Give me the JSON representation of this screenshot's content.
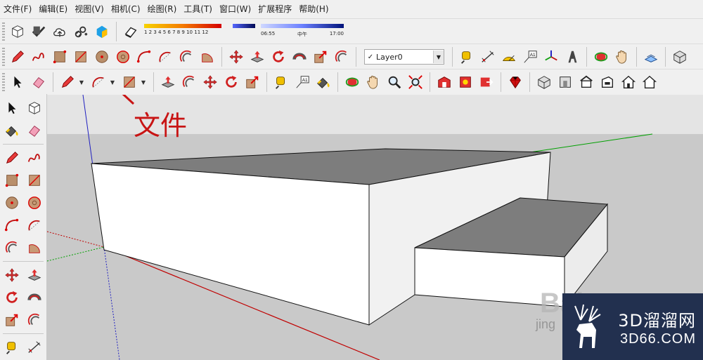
{
  "menubar": {
    "items": [
      {
        "label": "文件(F)"
      },
      {
        "label": "编辑(E)"
      },
      {
        "label": "视图(V)"
      },
      {
        "label": "相机(C)"
      },
      {
        "label": "绘图(R)"
      },
      {
        "label": "工具(T)"
      },
      {
        "label": "窗口(W)"
      },
      {
        "label": "扩展程序"
      },
      {
        "label": "帮助(H)"
      }
    ]
  },
  "toolbar": {
    "shadow_scale": "1 2 3 4 5 6 7 8 9 10 11 12",
    "time_start": "06:55",
    "time_mid": "中午",
    "time_end": "17:00",
    "layer_check": "✓",
    "layer_name": "Layer0"
  },
  "annotation": {
    "label": "文件",
    "color": "#c81414"
  },
  "watermark": {
    "brand_cn": "3D溜溜网",
    "brand_url": "3D66.COM",
    "bg_color": "#22304f"
  },
  "colors": {
    "red_axis": "#c00000",
    "green_axis": "#00a000",
    "blue_axis": "#2020c0",
    "sky": "#e4e4e4",
    "ground": "#c9c9c9",
    "face_white": "#ffffff",
    "face_top": "#7d7d7d"
  }
}
